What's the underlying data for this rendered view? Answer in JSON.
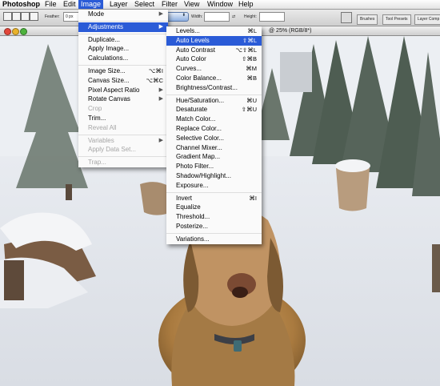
{
  "menubar": {
    "items": [
      "Photoshop",
      "File",
      "Edit",
      "Image",
      "Layer",
      "Select",
      "Filter",
      "View",
      "Window",
      "Help"
    ]
  },
  "options": {
    "feather_label": "Feather:",
    "feather_value": "0 px",
    "width_label": "Width:",
    "height_label": "Height:",
    "tabs": [
      "Brushes",
      "Tool Presets",
      "Layer Comp"
    ]
  },
  "document": {
    "title": "@ 25% (RGB/8*)"
  },
  "image_menu": {
    "rows": [
      {
        "label": "Mode",
        "arrow": "▶"
      },
      {
        "sep": true
      },
      {
        "label": "Adjustments",
        "arrow": "▶",
        "hl": true
      },
      {
        "sep": true
      },
      {
        "label": "Duplicate..."
      },
      {
        "label": "Apply Image..."
      },
      {
        "label": "Calculations..."
      },
      {
        "sep": true
      },
      {
        "label": "Image Size...",
        "sc": "⌥⌘I"
      },
      {
        "label": "Canvas Size...",
        "sc": "⌥⌘C"
      },
      {
        "label": "Pixel Aspect Ratio",
        "arrow": "▶"
      },
      {
        "label": "Rotate Canvas",
        "arrow": "▶"
      },
      {
        "label": "Crop",
        "dis": true
      },
      {
        "label": "Trim..."
      },
      {
        "label": "Reveal All",
        "dis": true
      },
      {
        "sep": true
      },
      {
        "label": "Variables",
        "arrow": "▶",
        "dis": true
      },
      {
        "label": "Apply Data Set...",
        "dis": true
      },
      {
        "sep": true
      },
      {
        "label": "Trap...",
        "dis": true
      }
    ]
  },
  "adjust_menu": {
    "rows": [
      {
        "label": "Levels...",
        "sc": "⌘L"
      },
      {
        "label": "Auto Levels",
        "sc": "⇧⌘L",
        "hl": true
      },
      {
        "label": "Auto Contrast",
        "sc": "⌥⇧⌘L"
      },
      {
        "label": "Auto Color",
        "sc": "⇧⌘B"
      },
      {
        "label": "Curves...",
        "sc": "⌘M"
      },
      {
        "label": "Color Balance...",
        "sc": "⌘B"
      },
      {
        "label": "Brightness/Contrast..."
      },
      {
        "sep": true
      },
      {
        "label": "Hue/Saturation...",
        "sc": "⌘U"
      },
      {
        "label": "Desaturate",
        "sc": "⇧⌘U"
      },
      {
        "label": "Match Color..."
      },
      {
        "label": "Replace Color..."
      },
      {
        "label": "Selective Color..."
      },
      {
        "label": "Channel Mixer..."
      },
      {
        "label": "Gradient Map..."
      },
      {
        "label": "Photo Filter..."
      },
      {
        "label": "Shadow/Highlight..."
      },
      {
        "label": "Exposure..."
      },
      {
        "sep": true
      },
      {
        "label": "Invert",
        "sc": "⌘I"
      },
      {
        "label": "Equalize"
      },
      {
        "label": "Threshold..."
      },
      {
        "label": "Posterize..."
      },
      {
        "sep": true
      },
      {
        "label": "Variations..."
      }
    ]
  },
  "colors": {
    "highlight": "#2a5bd7",
    "disabled_text": "#a6a6a6",
    "dog_fur": "#b58a4e"
  }
}
